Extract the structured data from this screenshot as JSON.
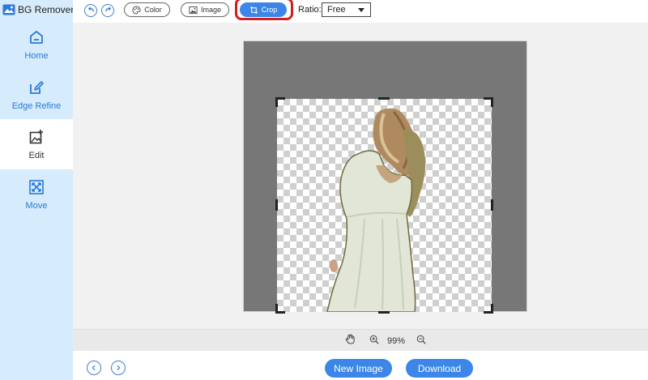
{
  "app": {
    "title": "BG Remover"
  },
  "sidebar": {
    "items": [
      {
        "label": "Home",
        "icon": "home-icon"
      },
      {
        "label": "Edge Refine",
        "icon": "edge-refine-icon"
      },
      {
        "label": "Edit",
        "icon": "edit-image-icon",
        "active": true
      },
      {
        "label": "Move",
        "icon": "move-icon"
      }
    ]
  },
  "toolbar": {
    "undo_icon": "undo-icon",
    "redo_icon": "redo-icon",
    "color_label": "Color",
    "image_label": "Image",
    "crop_label": "Crop",
    "ratio_label": "Ratio:",
    "ratio_value": "Free"
  },
  "zoom": {
    "value": "99%"
  },
  "footer": {
    "new_image_label": "New Image",
    "download_label": "Download"
  },
  "colors": {
    "accent": "#3d86e8",
    "sidebar_bg": "#d6ebfb",
    "highlight_red": "#d41d1d"
  }
}
